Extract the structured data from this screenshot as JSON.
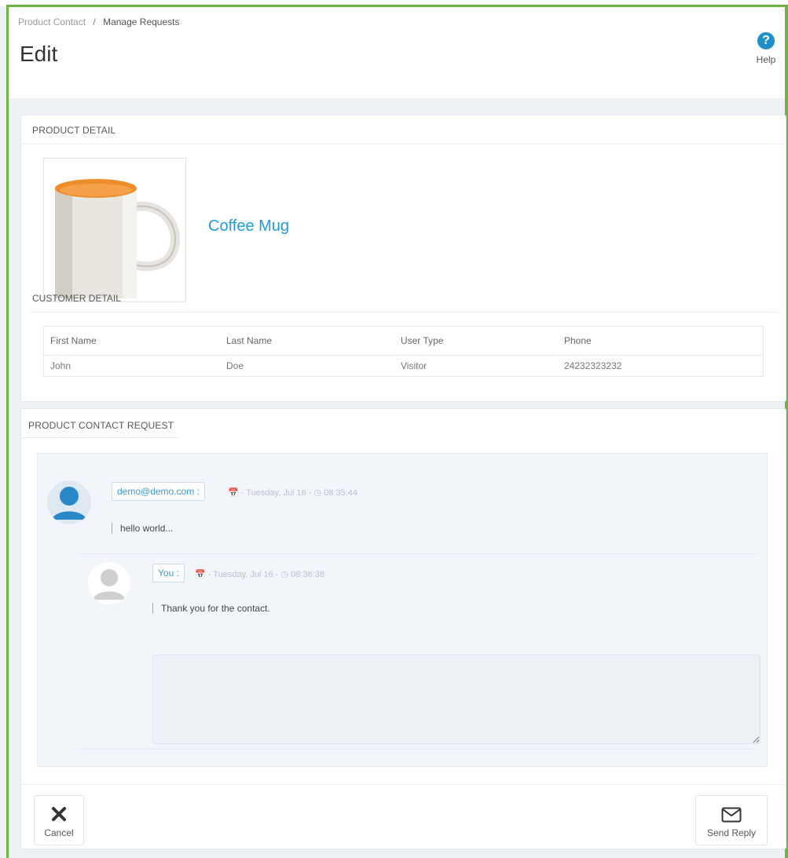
{
  "breadcrumb": {
    "parent": "Product Contact",
    "separator": "/",
    "current": "Manage Requests"
  },
  "page": {
    "title": "Edit"
  },
  "help": {
    "label": "Help"
  },
  "product_detail": {
    "heading": "PRODUCT DETAIL",
    "product_name": "Coffee Mug"
  },
  "customer_detail": {
    "heading": "CUSTOMER DETAIL",
    "columns": [
      "First Name",
      "Last Name",
      "User Type",
      "Phone"
    ],
    "rows": [
      [
        "John",
        "Doe",
        "Visitor",
        "24232323232"
      ]
    ]
  },
  "request": {
    "heading": "PRODUCT CONTACT REQUEST",
    "messages": [
      {
        "sender": "demo@demo.com :",
        "date": "- Tuesday, Jul 16 -",
        "time": "08:35:44",
        "text": "hello world..."
      },
      {
        "sender": "You :",
        "date": "- Tuesday, Jul 16 -",
        "time": "08:36:38",
        "text": "Thank you for the contact."
      }
    ],
    "reply_placeholder": ""
  },
  "actions": {
    "cancel_label": "Cancel",
    "send_label": "Send Reply"
  },
  "colors": {
    "accent": "#1f9bd8",
    "frame": "#6cb443",
    "avatar_blue": "#2a88c9",
    "avatar_gray": "#cfcfcf"
  }
}
